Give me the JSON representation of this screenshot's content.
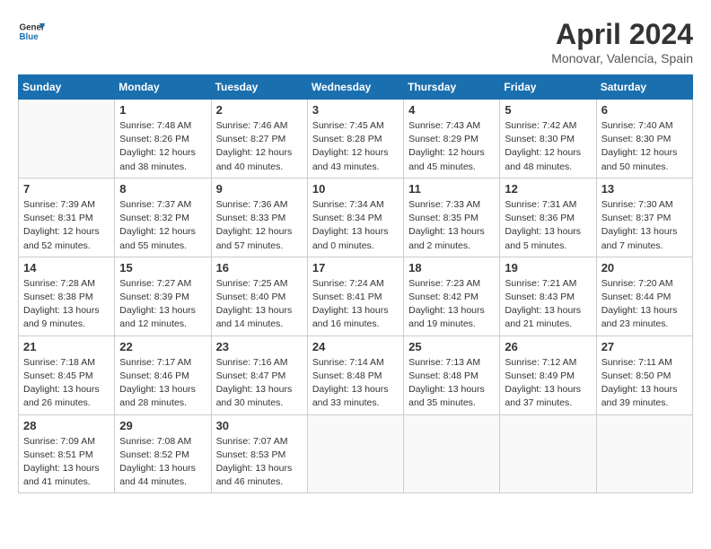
{
  "header": {
    "logo_line1": "General",
    "logo_line2": "Blue",
    "month_title": "April 2024",
    "location": "Monovar, Valencia, Spain"
  },
  "weekdays": [
    "Sunday",
    "Monday",
    "Tuesday",
    "Wednesday",
    "Thursday",
    "Friday",
    "Saturday"
  ],
  "weeks": [
    [
      {
        "day": "",
        "sunrise": "",
        "sunset": "",
        "daylight": ""
      },
      {
        "day": "1",
        "sunrise": "Sunrise: 7:48 AM",
        "sunset": "Sunset: 8:26 PM",
        "daylight": "Daylight: 12 hours and 38 minutes."
      },
      {
        "day": "2",
        "sunrise": "Sunrise: 7:46 AM",
        "sunset": "Sunset: 8:27 PM",
        "daylight": "Daylight: 12 hours and 40 minutes."
      },
      {
        "day": "3",
        "sunrise": "Sunrise: 7:45 AM",
        "sunset": "Sunset: 8:28 PM",
        "daylight": "Daylight: 12 hours and 43 minutes."
      },
      {
        "day": "4",
        "sunrise": "Sunrise: 7:43 AM",
        "sunset": "Sunset: 8:29 PM",
        "daylight": "Daylight: 12 hours and 45 minutes."
      },
      {
        "day": "5",
        "sunrise": "Sunrise: 7:42 AM",
        "sunset": "Sunset: 8:30 PM",
        "daylight": "Daylight: 12 hours and 48 minutes."
      },
      {
        "day": "6",
        "sunrise": "Sunrise: 7:40 AM",
        "sunset": "Sunset: 8:30 PM",
        "daylight": "Daylight: 12 hours and 50 minutes."
      }
    ],
    [
      {
        "day": "7",
        "sunrise": "Sunrise: 7:39 AM",
        "sunset": "Sunset: 8:31 PM",
        "daylight": "Daylight: 12 hours and 52 minutes."
      },
      {
        "day": "8",
        "sunrise": "Sunrise: 7:37 AM",
        "sunset": "Sunset: 8:32 PM",
        "daylight": "Daylight: 12 hours and 55 minutes."
      },
      {
        "day": "9",
        "sunrise": "Sunrise: 7:36 AM",
        "sunset": "Sunset: 8:33 PM",
        "daylight": "Daylight: 12 hours and 57 minutes."
      },
      {
        "day": "10",
        "sunrise": "Sunrise: 7:34 AM",
        "sunset": "Sunset: 8:34 PM",
        "daylight": "Daylight: 13 hours and 0 minutes."
      },
      {
        "day": "11",
        "sunrise": "Sunrise: 7:33 AM",
        "sunset": "Sunset: 8:35 PM",
        "daylight": "Daylight: 13 hours and 2 minutes."
      },
      {
        "day": "12",
        "sunrise": "Sunrise: 7:31 AM",
        "sunset": "Sunset: 8:36 PM",
        "daylight": "Daylight: 13 hours and 5 minutes."
      },
      {
        "day": "13",
        "sunrise": "Sunrise: 7:30 AM",
        "sunset": "Sunset: 8:37 PM",
        "daylight": "Daylight: 13 hours and 7 minutes."
      }
    ],
    [
      {
        "day": "14",
        "sunrise": "Sunrise: 7:28 AM",
        "sunset": "Sunset: 8:38 PM",
        "daylight": "Daylight: 13 hours and 9 minutes."
      },
      {
        "day": "15",
        "sunrise": "Sunrise: 7:27 AM",
        "sunset": "Sunset: 8:39 PM",
        "daylight": "Daylight: 13 hours and 12 minutes."
      },
      {
        "day": "16",
        "sunrise": "Sunrise: 7:25 AM",
        "sunset": "Sunset: 8:40 PM",
        "daylight": "Daylight: 13 hours and 14 minutes."
      },
      {
        "day": "17",
        "sunrise": "Sunrise: 7:24 AM",
        "sunset": "Sunset: 8:41 PM",
        "daylight": "Daylight: 13 hours and 16 minutes."
      },
      {
        "day": "18",
        "sunrise": "Sunrise: 7:23 AM",
        "sunset": "Sunset: 8:42 PM",
        "daylight": "Daylight: 13 hours and 19 minutes."
      },
      {
        "day": "19",
        "sunrise": "Sunrise: 7:21 AM",
        "sunset": "Sunset: 8:43 PM",
        "daylight": "Daylight: 13 hours and 21 minutes."
      },
      {
        "day": "20",
        "sunrise": "Sunrise: 7:20 AM",
        "sunset": "Sunset: 8:44 PM",
        "daylight": "Daylight: 13 hours and 23 minutes."
      }
    ],
    [
      {
        "day": "21",
        "sunrise": "Sunrise: 7:18 AM",
        "sunset": "Sunset: 8:45 PM",
        "daylight": "Daylight: 13 hours and 26 minutes."
      },
      {
        "day": "22",
        "sunrise": "Sunrise: 7:17 AM",
        "sunset": "Sunset: 8:46 PM",
        "daylight": "Daylight: 13 hours and 28 minutes."
      },
      {
        "day": "23",
        "sunrise": "Sunrise: 7:16 AM",
        "sunset": "Sunset: 8:47 PM",
        "daylight": "Daylight: 13 hours and 30 minutes."
      },
      {
        "day": "24",
        "sunrise": "Sunrise: 7:14 AM",
        "sunset": "Sunset: 8:48 PM",
        "daylight": "Daylight: 13 hours and 33 minutes."
      },
      {
        "day": "25",
        "sunrise": "Sunrise: 7:13 AM",
        "sunset": "Sunset: 8:48 PM",
        "daylight": "Daylight: 13 hours and 35 minutes."
      },
      {
        "day": "26",
        "sunrise": "Sunrise: 7:12 AM",
        "sunset": "Sunset: 8:49 PM",
        "daylight": "Daylight: 13 hours and 37 minutes."
      },
      {
        "day": "27",
        "sunrise": "Sunrise: 7:11 AM",
        "sunset": "Sunset: 8:50 PM",
        "daylight": "Daylight: 13 hours and 39 minutes."
      }
    ],
    [
      {
        "day": "28",
        "sunrise": "Sunrise: 7:09 AM",
        "sunset": "Sunset: 8:51 PM",
        "daylight": "Daylight: 13 hours and 41 minutes."
      },
      {
        "day": "29",
        "sunrise": "Sunrise: 7:08 AM",
        "sunset": "Sunset: 8:52 PM",
        "daylight": "Daylight: 13 hours and 44 minutes."
      },
      {
        "day": "30",
        "sunrise": "Sunrise: 7:07 AM",
        "sunset": "Sunset: 8:53 PM",
        "daylight": "Daylight: 13 hours and 46 minutes."
      },
      {
        "day": "",
        "sunrise": "",
        "sunset": "",
        "daylight": ""
      },
      {
        "day": "",
        "sunrise": "",
        "sunset": "",
        "daylight": ""
      },
      {
        "day": "",
        "sunrise": "",
        "sunset": "",
        "daylight": ""
      },
      {
        "day": "",
        "sunrise": "",
        "sunset": "",
        "daylight": ""
      }
    ]
  ]
}
